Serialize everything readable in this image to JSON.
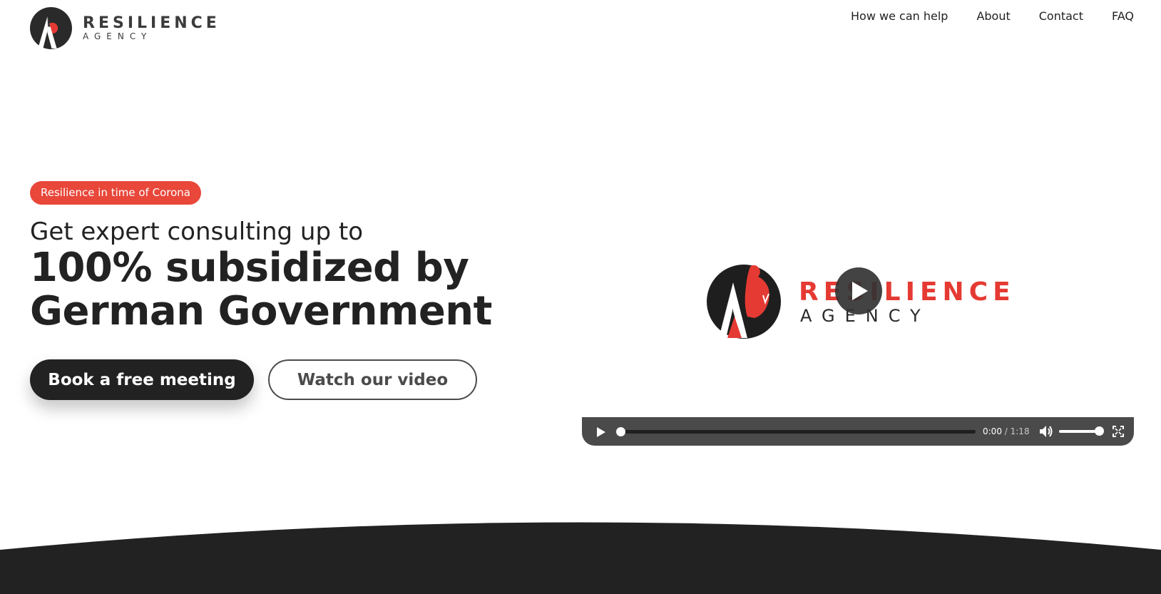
{
  "header": {
    "logo": {
      "word1": "RESILIENCE",
      "word2": "AGENCY"
    },
    "nav": [
      "How we can help",
      "About",
      "Contact",
      "FAQ"
    ]
  },
  "hero": {
    "badge": "Resilience in time of Corona",
    "subtitle": "Get expert consulting up to",
    "headline_line1": "100% subsidized by",
    "headline_line2": "German Government",
    "primary_button": "Book a free meeting",
    "secondary_button": "Watch our video"
  },
  "video": {
    "poster_word1": "RESILIENCE",
    "poster_word2": "AGENCY",
    "current_time": "0:00",
    "separator": " / ",
    "duration": "1:18",
    "progress": 0,
    "volume": 1
  },
  "colors": {
    "accent": "#e8473a",
    "dark": "#222222",
    "controls_bg": "#4a4a4a"
  },
  "icons": {
    "logo": "resilience-logo-mark",
    "big_play": "play-icon",
    "play": "play-icon",
    "volume": "speaker-icon",
    "fullscreen": "fullscreen-icon"
  }
}
